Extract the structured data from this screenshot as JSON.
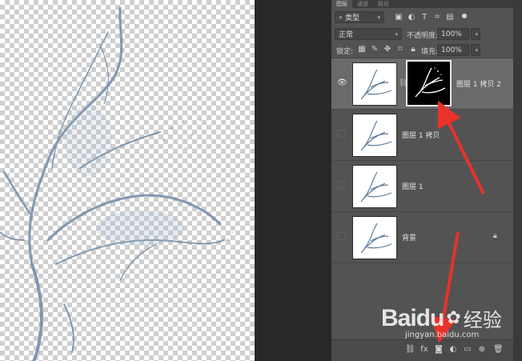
{
  "panel": {
    "tabs": [
      "图层",
      "通道",
      "路径"
    ],
    "kind_filter": "类型",
    "blend_mode": "正常",
    "opacity_label": "不透明度:",
    "opacity_value": "100%",
    "lock_label": "锁定:",
    "fill_label": "填充:",
    "fill_value": "100%"
  },
  "layers": [
    {
      "name": "图层 1 拷贝 2",
      "visible": true,
      "selected": true,
      "has_mask": true
    },
    {
      "name": "图层 1 拷贝",
      "visible": false,
      "selected": false
    },
    {
      "name": "图层 1",
      "visible": false,
      "selected": false
    },
    {
      "name": "背景",
      "visible": false,
      "selected": false,
      "locked": true
    }
  ],
  "watermark": {
    "brand": "Baidu",
    "brand_cn": "经验",
    "url": "jingyan.baidu.com"
  },
  "colors": {
    "panel_bg": "#535353",
    "selected_row": "#6a6a6a",
    "arrow": "#e8322b"
  }
}
